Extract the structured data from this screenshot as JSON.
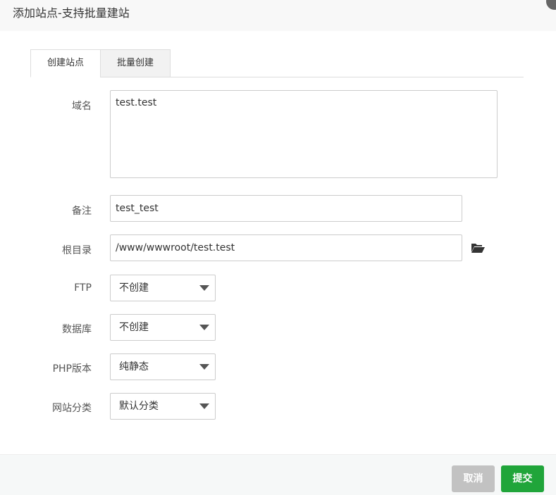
{
  "dialog": {
    "title": "添加站点-支持批量建站"
  },
  "tabs": [
    {
      "label": "创建站点",
      "active": true
    },
    {
      "label": "批量创建",
      "active": false
    }
  ],
  "form": {
    "domain": {
      "label": "域名",
      "value": "test.test"
    },
    "remark": {
      "label": "备注",
      "value": "test_test"
    },
    "root": {
      "label": "根目录",
      "value": "/www/wwwroot/test.test",
      "icon": "folder-open-icon"
    },
    "ftp": {
      "label": "FTP",
      "value": "不创建"
    },
    "database": {
      "label": "数据库",
      "value": "不创建"
    },
    "php": {
      "label": "PHP版本",
      "value": "纯静态"
    },
    "category": {
      "label": "网站分类",
      "value": "默认分类"
    }
  },
  "footer": {
    "cancel_label": "取消",
    "submit_label": "提交"
  },
  "colors": {
    "submit": "#20a53a",
    "cancel": "#c2c2c2"
  }
}
